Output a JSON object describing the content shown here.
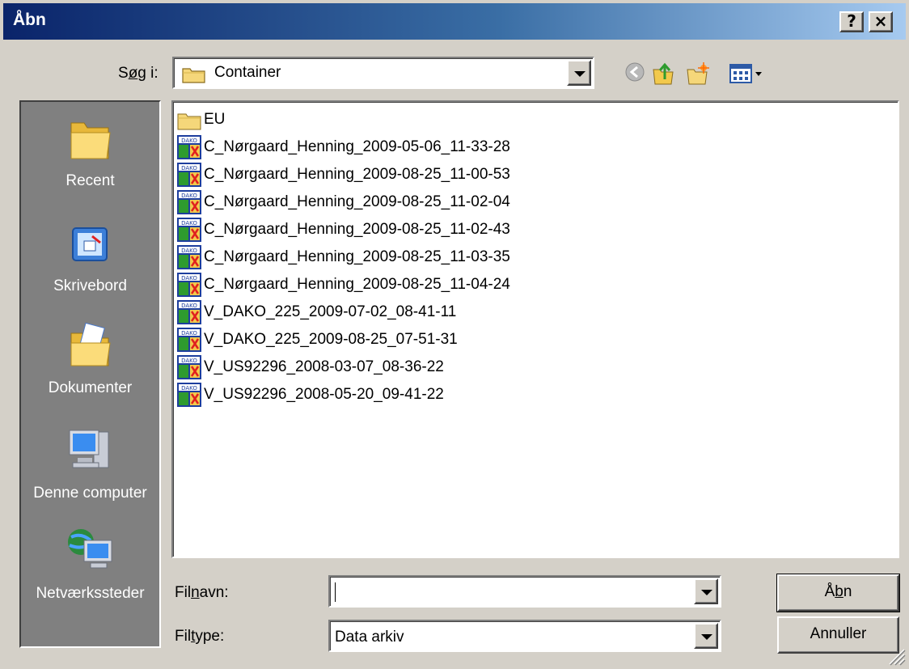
{
  "window": {
    "title": "Åbn",
    "help_label": "?",
    "close_label": "×"
  },
  "lookin": {
    "label_pre": "S",
    "label_accel": "ø",
    "label_post": "g i:",
    "value": "Container"
  },
  "toolbar": {
    "icons": [
      "back-icon",
      "up-folder-icon",
      "new-folder-icon",
      "view-menu-icon"
    ]
  },
  "places": [
    {
      "label": "Recent",
      "icon": "recent-folder-icon"
    },
    {
      "label": "Skrivebord",
      "icon": "desktop-icon"
    },
    {
      "label": "Dokumenter",
      "icon": "documents-folder-icon"
    },
    {
      "label": "Denne computer",
      "icon": "my-computer-icon"
    },
    {
      "label": "Netværkssteder",
      "icon": "network-places-icon"
    }
  ],
  "files": [
    {
      "name": "EU",
      "type": "folder"
    },
    {
      "name": "C_Nørgaard_Henning_2009-05-06_11-33-28",
      "type": "dako"
    },
    {
      "name": "C_Nørgaard_Henning_2009-08-25_11-00-53",
      "type": "dako"
    },
    {
      "name": "C_Nørgaard_Henning_2009-08-25_11-02-04",
      "type": "dako"
    },
    {
      "name": "C_Nørgaard_Henning_2009-08-25_11-02-43",
      "type": "dako"
    },
    {
      "name": "C_Nørgaard_Henning_2009-08-25_11-03-35",
      "type": "dako"
    },
    {
      "name": "C_Nørgaard_Henning_2009-08-25_11-04-24",
      "type": "dako"
    },
    {
      "name": "V_DAKO_225_2009-07-02_08-41-11",
      "type": "dako"
    },
    {
      "name": "V_DAKO_225_2009-08-25_07-51-31",
      "type": "dako"
    },
    {
      "name": "V_US92296_2008-03-07_08-36-22",
      "type": "dako"
    },
    {
      "name": "V_US92296_2008-05-20_09-41-22",
      "type": "dako"
    }
  ],
  "filename": {
    "label_pre": "Fil",
    "label_accel": "n",
    "label_post": "avn:",
    "value": ""
  },
  "filetype": {
    "label_pre": "Fil",
    "label_accel": "t",
    "label_post": "ype:",
    "value": "Data arkiv"
  },
  "buttons": {
    "open_pre": "Å",
    "open_accel": "b",
    "open_post": "n",
    "cancel": "Annuller"
  }
}
